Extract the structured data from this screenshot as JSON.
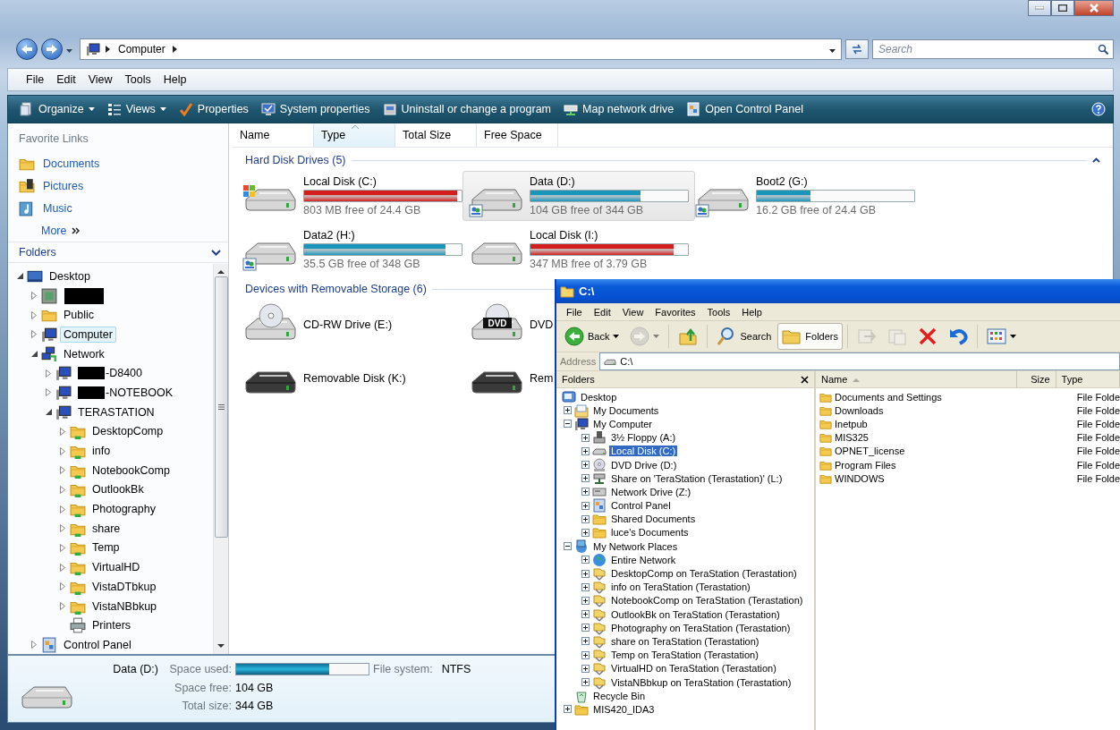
{
  "address_bar": {
    "path": [
      "Computer"
    ],
    "search": {
      "placeholder": "Search"
    }
  },
  "menu_bar": [
    "File",
    "Edit",
    "View",
    "Tools",
    "Help"
  ],
  "command_bar": [
    {
      "label": "Organize",
      "kind": "organize",
      "dropdown": true
    },
    {
      "label": "Views",
      "kind": "views",
      "dropdown": true
    },
    {
      "label": "Properties",
      "kind": "properties",
      "dropdown": false
    },
    {
      "label": "System properties",
      "kind": "system",
      "dropdown": false
    },
    {
      "label": "Uninstall or change a program",
      "kind": "uninstall",
      "dropdown": false
    },
    {
      "label": "Map network drive",
      "kind": "netdrive",
      "dropdown": false
    },
    {
      "label": "Open Control Panel",
      "kind": "panel",
      "dropdown": false
    }
  ],
  "favorite_links": {
    "title": "Favorite Links",
    "items": [
      {
        "label": "Documents",
        "kind": "documents"
      },
      {
        "label": "Pictures",
        "kind": "pictures"
      },
      {
        "label": "Music",
        "kind": "music"
      }
    ],
    "more": "More"
  },
  "folders": {
    "title": "Folders",
    "tree": [
      {
        "label": "Desktop",
        "kind": "desktop",
        "expanded": true,
        "selected": false,
        "children": [
          {
            "kind": "user",
            "redacted": true,
            "expanded": false,
            "selected": false
          },
          {
            "label": "Public",
            "kind": "folder",
            "expanded": false,
            "selected": false
          },
          {
            "label": "Computer",
            "kind": "computer",
            "expanded": false,
            "selected": true
          },
          {
            "label": "Network",
            "kind": "network",
            "expanded": true,
            "selected": false,
            "children": [
              {
                "label": "-D8400",
                "kind": "computer",
                "redacted": true,
                "expanded": false,
                "selected": false
              },
              {
                "label": "-NOTEBOOK",
                "kind": "computer",
                "redacted": true,
                "expanded": false,
                "selected": false
              },
              {
                "label": "TERASTATION",
                "kind": "computer",
                "expanded": true,
                "selected": false,
                "children": [
                  {
                    "label": "DesktopComp",
                    "kind": "share",
                    "expanded": false,
                    "selected": false
                  },
                  {
                    "label": "info",
                    "kind": "share",
                    "expanded": false,
                    "selected": false
                  },
                  {
                    "label": "NotebookComp",
                    "kind": "share",
                    "expanded": false,
                    "selected": false
                  },
                  {
                    "label": "OutlookBk",
                    "kind": "share",
                    "expanded": false,
                    "selected": false
                  },
                  {
                    "label": "Photography",
                    "kind": "share",
                    "expanded": false,
                    "selected": false
                  },
                  {
                    "label": "share",
                    "kind": "share",
                    "expanded": false,
                    "selected": false
                  },
                  {
                    "label": "Temp",
                    "kind": "share",
                    "expanded": false,
                    "selected": false
                  },
                  {
                    "label": "VirtualHD",
                    "kind": "share",
                    "expanded": false,
                    "selected": false
                  },
                  {
                    "label": "VistaDTbkup",
                    "kind": "share",
                    "expanded": false,
                    "selected": false
                  },
                  {
                    "label": "VistaNBbkup",
                    "kind": "share",
                    "expanded": false,
                    "selected": false
                  },
                  {
                    "label": "Printers",
                    "kind": "printer",
                    "selected": false
                  }
                ]
              }
            ]
          },
          {
            "label": "Control Panel",
            "kind": "panel",
            "expanded": false,
            "selected": false
          }
        ]
      }
    ]
  },
  "columns": [
    {
      "label": "Name",
      "sorted": false
    },
    {
      "label": "Type",
      "sorted": true
    },
    {
      "label": "Total Size",
      "sorted": false
    },
    {
      "label": "Free Space",
      "sorted": false
    }
  ],
  "groups": [
    {
      "title": "Hard Disk Drives (5)",
      "items": [
        {
          "name": "Local Disk (C:)",
          "kind": "windows",
          "free": "803 MB free of 24.4 GB",
          "level": 0.97,
          "color": "#d41e1e",
          "selected": false
        },
        {
          "name": "Data (D:)",
          "kind": "shared",
          "free": "104 GB free of 344 GB",
          "level": 0.7,
          "color": "#1a96bd",
          "selected": true
        },
        {
          "name": "Boot2 (G:)",
          "kind": "shared",
          "free": "16.2 GB free of 24.4 GB",
          "level": 0.34,
          "color": "#1a96bd",
          "selected": false
        },
        {
          "name": "Data2 (H:)",
          "kind": "shared",
          "free": "35.5 GB free of 348 GB",
          "level": 0.9,
          "color": "#1a96bd",
          "selected": false
        },
        {
          "name": "Local Disk (I:)",
          "kind": "plain",
          "free": "347 MB free of 3.79 GB",
          "level": 0.91,
          "color": "#d41e1e",
          "selected": false
        }
      ]
    },
    {
      "title": "Devices with Removable Storage (6)",
      "items": [
        {
          "name": "CD-RW Drive (E:)",
          "kind": "cd",
          "selected": false
        },
        {
          "name": "DVD",
          "kind": "dvd",
          "badge": "DVD",
          "selected": false
        },
        {
          "name": "Removable Disk (K:)",
          "kind": "removable",
          "selected": false
        },
        {
          "name": "Rem",
          "kind": "removable",
          "selected": false
        }
      ]
    }
  ],
  "details": {
    "name": "Data (D:)",
    "space_used": {
      "label": "Space used:",
      "level": 0.7
    },
    "file_system": {
      "label": "File system:",
      "value": "NTFS"
    },
    "space_free": {
      "label": "Space free:",
      "value": "104 GB"
    },
    "total_size": {
      "label": "Total size:",
      "value": "344 GB"
    }
  },
  "xp_window": {
    "title": "C:\\",
    "menu": [
      "File",
      "Edit",
      "View",
      "Favorites",
      "Tools",
      "Help"
    ],
    "toolbar": [
      {
        "label": "Back",
        "kind": "back",
        "disabled": false,
        "pressed": false,
        "dropdown": true
      },
      {
        "kind": "forward",
        "disabled": true,
        "pressed": false,
        "dropdown": true
      },
      {
        "kind": "up",
        "disabled": false,
        "pressed": false,
        "dropdown": false
      },
      {
        "label": "Search",
        "kind": "search",
        "disabled": false,
        "pressed": false,
        "dropdown": false
      },
      {
        "label": "Folders",
        "kind": "folders",
        "disabled": false,
        "pressed": true,
        "dropdown": false
      },
      {
        "kind": "move",
        "disabled": true,
        "pressed": false,
        "dropdown": false
      },
      {
        "kind": "copy",
        "disabled": true,
        "pressed": false,
        "dropdown": false
      },
      {
        "kind": "delete",
        "disabled": false,
        "pressed": false,
        "dropdown": false
      },
      {
        "kind": "undo",
        "disabled": false,
        "pressed": false,
        "dropdown": false
      },
      {
        "kind": "viewsxp",
        "disabled": false,
        "pressed": false,
        "dropdown": true
      }
    ],
    "address": {
      "label": "Address",
      "value": "C:\\"
    },
    "folders": {
      "title": "Folders",
      "tree": [
        {
          "label": "Desktop",
          "kind": "xpdesktop",
          "selected": false,
          "children": [
            {
              "label": "My Documents",
              "kind": "xpdocs",
              "expanded": false,
              "selected": false
            },
            {
              "label": "My Computer",
              "kind": "computer",
              "expanded": true,
              "selected": false,
              "children": [
                {
                  "label": "3½ Floppy (A:)",
                  "kind": "floppy",
                  "expanded": false,
                  "selected": false
                },
                {
                  "label": "Local Disk (C:)",
                  "kind": "hdd",
                  "expanded": false,
                  "selected": true
                },
                {
                  "label": "DVD Drive (D:)",
                  "kind": "disc",
                  "expanded": false,
                  "selected": false
                },
                {
                  "label": "Share on 'TeraStation (Terastation)' (L:)",
                  "kind": "netshare",
                  "expanded": false,
                  "selected": false
                },
                {
                  "label": "Network Drive (Z:)",
                  "kind": "netdrivexp",
                  "expanded": false,
                  "selected": false
                },
                {
                  "label": "Control Panel",
                  "kind": "panel",
                  "expanded": false,
                  "selected": false
                },
                {
                  "label": "Shared Documents",
                  "kind": "folder",
                  "expanded": false,
                  "selected": false
                },
                {
                  "label": "luce's Documents",
                  "kind": "folder",
                  "expanded": false,
                  "selected": false
                }
              ]
            },
            {
              "label": "My Network Places",
              "kind": "places",
              "expanded": true,
              "selected": false,
              "children": [
                {
                  "label": "Entire Network",
                  "kind": "globe",
                  "expanded": false,
                  "selected": false
                },
                {
                  "label": "DesktopComp on TeraStation (Terastation)",
                  "kind": "xpshare",
                  "expanded": false,
                  "selected": false
                },
                {
                  "label": "info on TeraStation (Terastation)",
                  "kind": "xpshare",
                  "expanded": false,
                  "selected": false
                },
                {
                  "label": "NotebookComp on TeraStation (Terastation)",
                  "kind": "xpshare",
                  "expanded": false,
                  "selected": false
                },
                {
                  "label": "OutlookBk on TeraStation (Terastation)",
                  "kind": "xpshare",
                  "expanded": false,
                  "selected": false
                },
                {
                  "label": "Photography on TeraStation (Terastation)",
                  "kind": "xpshare",
                  "expanded": false,
                  "selected": false
                },
                {
                  "label": "share on TeraStation (Terastation)",
                  "kind": "xpshare",
                  "expanded": false,
                  "selected": false
                },
                {
                  "label": "Temp on TeraStation (Terastation)",
                  "kind": "xpshare",
                  "expanded": false,
                  "selected": false
                },
                {
                  "label": "VirtualHD on TeraStation (Terastation)",
                  "kind": "xpshare",
                  "expanded": false,
                  "selected": false
                },
                {
                  "label": "VistaNBbkup on TeraStation (Terastation)",
                  "kind": "xpshare",
                  "expanded": false,
                  "selected": false
                }
              ]
            },
            {
              "label": "Recycle Bin",
              "kind": "recycle",
              "selected": false
            },
            {
              "label": "MIS420_IDA3",
              "kind": "folder",
              "expanded": false,
              "selected": false
            }
          ]
        }
      ]
    },
    "files": {
      "columns": [
        {
          "label": "Name",
          "sorted": true
        },
        {
          "label": "Size",
          "sorted": false
        },
        {
          "label": "Type",
          "sorted": false
        }
      ],
      "rows": [
        {
          "name": "Documents and Settings",
          "type": "File Folde"
        },
        {
          "name": "Downloads",
          "type": "File Folde"
        },
        {
          "name": "Inetpub",
          "type": "File Folde"
        },
        {
          "name": "MIS325",
          "type": "File Folde"
        },
        {
          "name": "OPNET_license",
          "type": "File Folde"
        },
        {
          "name": "Program Files",
          "type": "File Folde"
        },
        {
          "name": "WINDOWS",
          "type": "File Folde"
        }
      ]
    }
  }
}
